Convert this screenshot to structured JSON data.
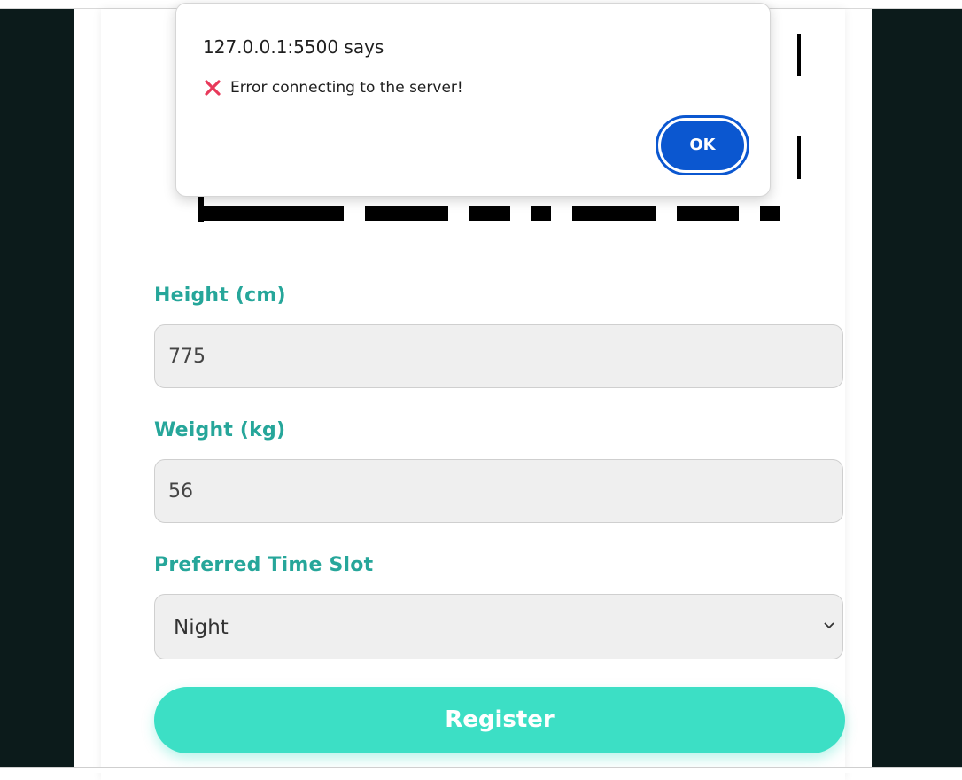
{
  "dialog": {
    "title": "127.0.0.1:5500 says",
    "message": "Error connecting to the server!",
    "message_icon": "cross-mark-icon",
    "ok_label": "OK"
  },
  "form": {
    "height": {
      "label": "Height (cm)",
      "value": "775"
    },
    "weight": {
      "label": "Weight (kg)",
      "value": "56"
    },
    "time_slot": {
      "label": "Preferred Time Slot",
      "selected": "Night"
    },
    "register_label": "Register"
  },
  "colors": {
    "label": "#26a69a",
    "register_button": "#3cdfc5",
    "ok_button": "#0b57d0",
    "side_background": "#0c1b1b",
    "error_icon": "#e8395a"
  }
}
